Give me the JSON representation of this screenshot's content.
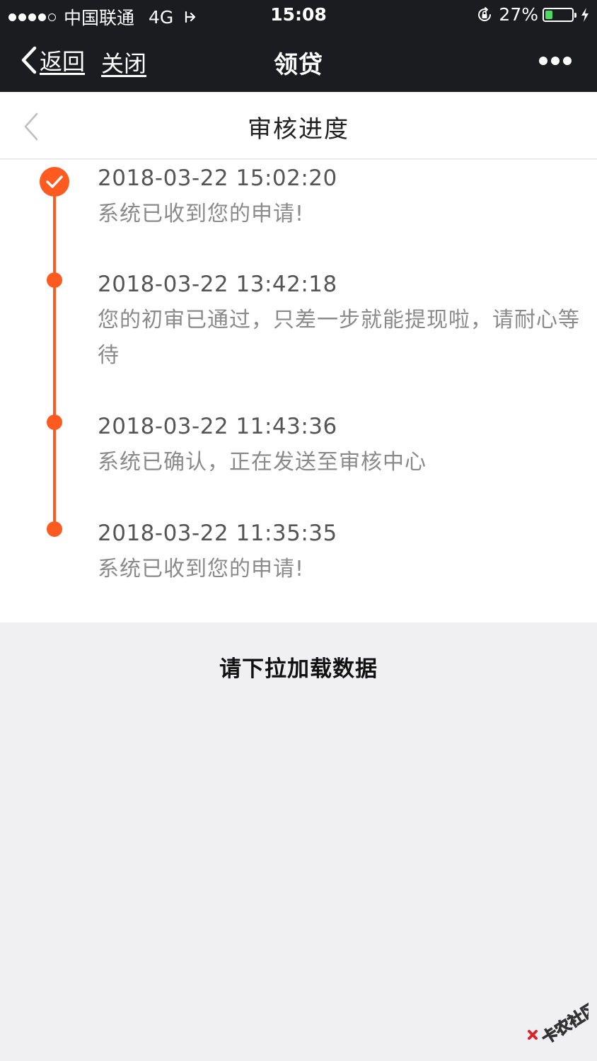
{
  "status_bar": {
    "carrier": "中国联通",
    "network": "4G",
    "time": "15:08",
    "battery_percent": "27%",
    "battery_level": 0.27,
    "battery_color": "#4cd964"
  },
  "nav_bar": {
    "back_label": "返回",
    "close_label": "关闭",
    "title": "领贷"
  },
  "page": {
    "title": "审核进度"
  },
  "timeline": {
    "accent_color": "#ff5a1f",
    "items": [
      {
        "time": "2018-03-22 15:02:20",
        "message": "系统已收到您的申请!"
      },
      {
        "time": "2018-03-22 13:42:18",
        "message": "您的初审已通过，只差一步就能提现啦，请耐心等待"
      },
      {
        "time": "2018-03-22 11:43:36",
        "message": "系统已确认，正在发送至审核中心"
      },
      {
        "time": "2018-03-22 11:35:35",
        "message": "系统已收到您的申请!"
      }
    ]
  },
  "pull_hint": "请下拉加载数据",
  "watermark_text": "卡农社区"
}
